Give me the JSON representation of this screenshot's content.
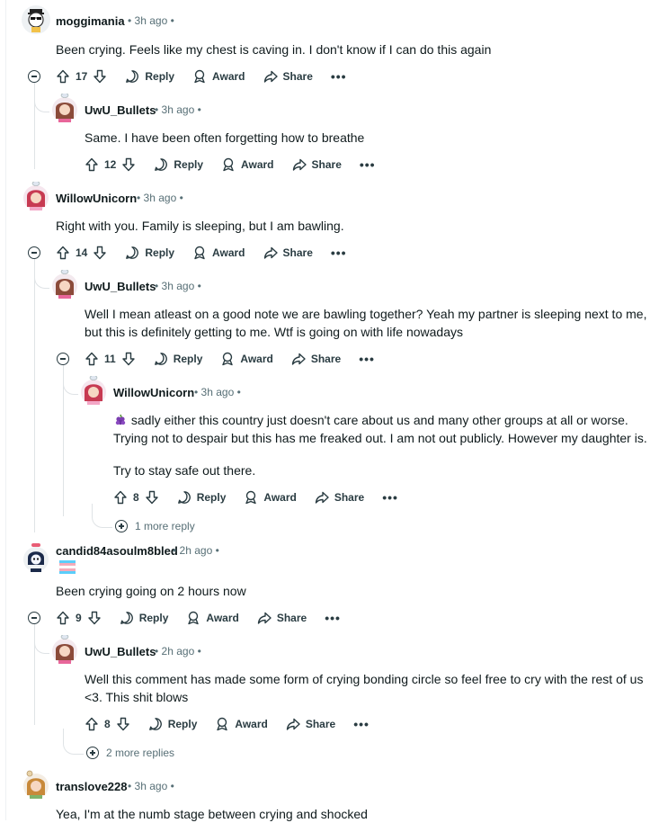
{
  "comments": [
    {
      "id": "c1",
      "user": "moggimania",
      "time": "3h ago",
      "text": "Been crying. Feels like my chest is caving in. I don't know if I can do this again",
      "votes": "17"
    },
    {
      "id": "c2",
      "user": "UwU_Bullets",
      "time": "3h ago",
      "text": "Same. I have been often forgetting how to breathe",
      "votes": "12"
    },
    {
      "id": "c3",
      "user": "WillowUnicorn",
      "time": "3h ago",
      "text": "Right with you. Family is sleeping, but I am bawling.",
      "votes": "14"
    },
    {
      "id": "c4",
      "user": "UwU_Bullets",
      "time": "3h ago",
      "text": "Well I mean atleast on a good note we are bawling together? Yeah my partner is sleeping next to me, but this is definitely getting to me. Wtf is going on with life nowadays",
      "votes": "11"
    },
    {
      "id": "c5",
      "user": "WillowUnicorn",
      "time": "3h ago",
      "text": "sadly either this country just doesn't care about us and many other groups at all or worse. Trying not to despair but this has me freaked out. I am not out publicly. However my daughter is.",
      "text2": "Try to stay safe out there.",
      "votes": "8",
      "more": "1 more reply"
    },
    {
      "id": "c6",
      "user": "candid84asoulm8bled",
      "time": "2h ago",
      "text": "Been crying going on 2 hours now",
      "votes": "9"
    },
    {
      "id": "c7",
      "user": "UwU_Bullets",
      "time": "2h ago",
      "text": "Well this comment has made some form of crying bonding circle so feel free to cry with the rest of us <3. This shit blows",
      "votes": "8",
      "more": "2 more replies"
    },
    {
      "id": "c8",
      "user": "translove228",
      "time": "3h ago",
      "text": "Yea, I'm at the numb stage between crying and shocked"
    }
  ],
  "labels": {
    "reply": "Reply",
    "award": "Award",
    "share": "Share",
    "more": "•••",
    "sep": "•"
  },
  "colors": {
    "thread_line": "#dfe3e6",
    "meta": "#576f76",
    "text": "#0f1a1c"
  }
}
